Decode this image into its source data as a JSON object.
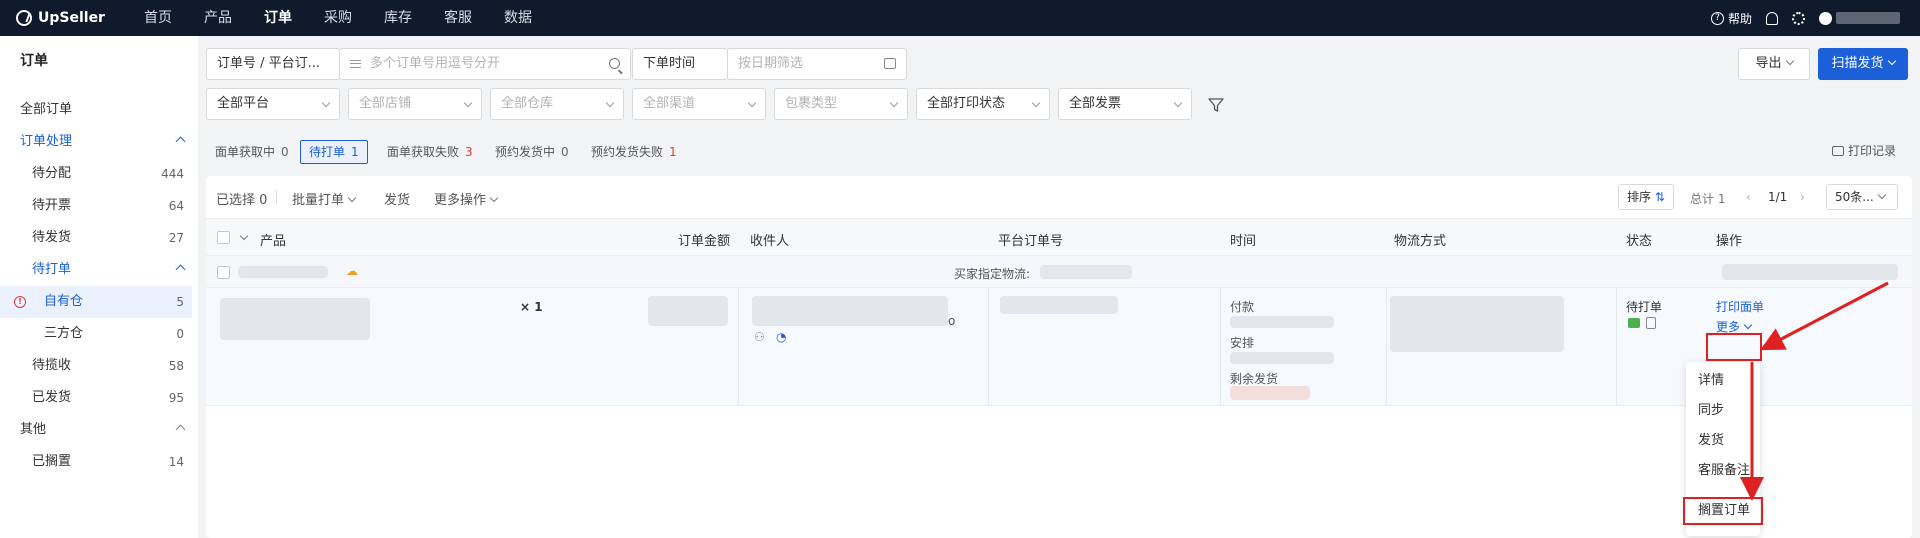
{
  "app": {
    "name": "UpSeller"
  },
  "nav": [
    "首页",
    "产品",
    "订单",
    "采购",
    "库存",
    "客服",
    "数据"
  ],
  "top_right": {
    "help": "帮助"
  },
  "sidebar": {
    "title": "订单",
    "all_orders": "全部订单",
    "processing": "订单处理",
    "items": [
      {
        "label": "待分配",
        "count": "444"
      },
      {
        "label": "待开票",
        "count": "64"
      },
      {
        "label": "待发货",
        "count": "27"
      }
    ],
    "to_print": "待打单",
    "own_warehouse": {
      "label": "自有仓",
      "count": "5"
    },
    "third_warehouse": {
      "label": "三方仓",
      "count": "0"
    },
    "to_pickup": {
      "label": "待揽收",
      "count": "58"
    },
    "shipped": {
      "label": "已发货",
      "count": "95"
    },
    "others": "其他",
    "shelved": {
      "label": "已搁置",
      "count": "14"
    }
  },
  "filters": {
    "order_no_type": "订单号 / 平台订...",
    "order_no_placeholder": "多个订单号用逗号分开",
    "time_type": "下单时间",
    "date_placeholder": "按日期筛选",
    "platform": "全部平台",
    "shop": "全部店铺",
    "warehouse": "全部仓库",
    "channel": "全部渠道",
    "package_type": "包裹类型",
    "print_status": "全部打印状态",
    "invoice": "全部发票",
    "export": "导出",
    "scan_ship": "扫描发货"
  },
  "tabs": [
    {
      "label": "面单获取中",
      "count": "0",
      "red": false
    },
    {
      "label": "待打单",
      "count": "1",
      "red": false
    },
    {
      "label": "面单获取失败",
      "count": "3",
      "red": true
    },
    {
      "label": "预约发货中",
      "count": "0",
      "red": false
    },
    {
      "label": "预约发货失败",
      "count": "1",
      "red": true
    }
  ],
  "print_log": "打印记录",
  "toolbar": {
    "selected": "已选择 0",
    "batch_print": "批量打单",
    "ship": "发货",
    "more_actions": "更多操作",
    "sort": "排序",
    "total": "总计 1",
    "page": "1/1",
    "page_size": "50条..."
  },
  "table_headers": {
    "product": "产品",
    "amount": "订单金额",
    "recipient": "收件人",
    "platform_order_no": "平台订单号",
    "time": "时间",
    "logistics": "物流方式",
    "status": "状态",
    "action": "操作"
  },
  "group_row": {
    "buyer_logistics": "买家指定物流:"
  },
  "order": {
    "qty": "× 1",
    "recipient_suffix": "o",
    "time_paid": "付款",
    "time_arranged": "安排",
    "time_remaining": "剩余发货",
    "status": "待打单",
    "print_label": "打印面单",
    "more": "更多"
  },
  "more_menu": [
    "详情",
    "同步",
    "发货",
    "客服备注",
    "搁置订单"
  ],
  "colors": {
    "primary": "#1b5fd9",
    "nav_bg": "#0f1b2d",
    "annotation_red": "#e02020"
  }
}
